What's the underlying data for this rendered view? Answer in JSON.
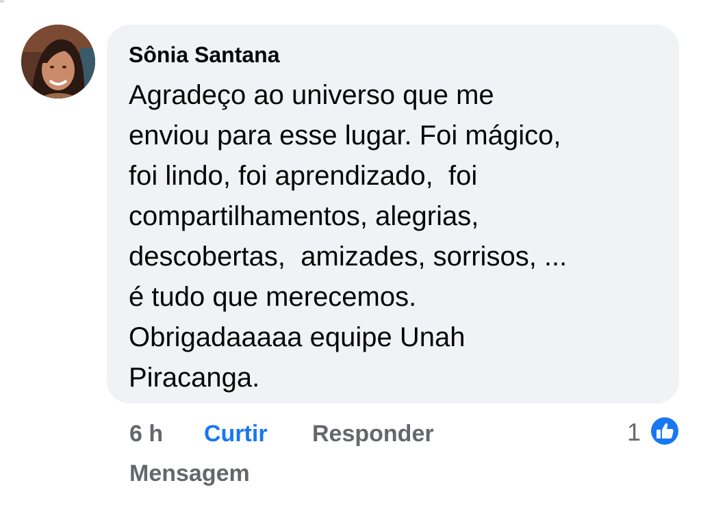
{
  "comment": {
    "author": "Sônia Santana",
    "text": "Agradeço ao universo que me\nenviou para esse lugar. Foi mágico,\nfoi lindo, foi aprendizado,  foi\ncompartilhamentos, alegrias,\ndescobertas,  amizades, sorrisos, ...\né tudo que merecemos.\nObrigadaaaaa equipe Unah\nPiracanga.",
    "avatar_icon": "profile-photo"
  },
  "actions": {
    "time": "6 h",
    "like_label": "Curtir",
    "reply_label": "Responder",
    "message_label": "Mensagem"
  },
  "reactions": {
    "count": "1",
    "icon": "like-thumb-icon",
    "color": "#1877f2"
  },
  "colors": {
    "bubble": "#f0f2f5",
    "accent": "#1877f2",
    "muted": "#65676b"
  }
}
